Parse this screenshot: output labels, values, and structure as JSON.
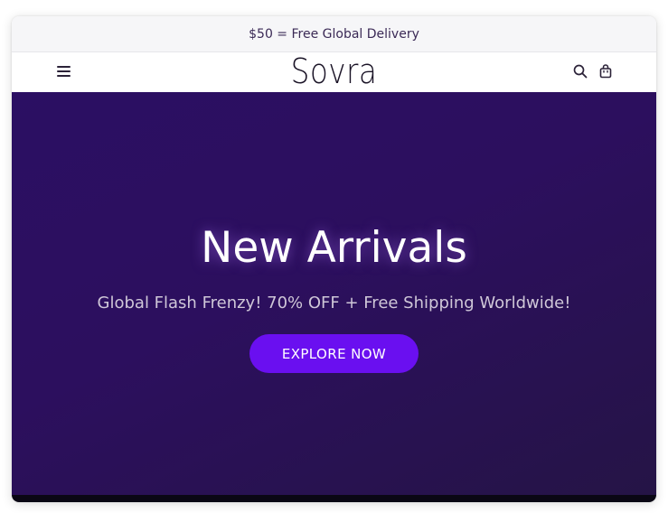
{
  "announcement": {
    "text": "$50 = Free Global Delivery"
  },
  "header": {
    "logo": "Sovra",
    "menu_icon": "hamburger-menu-icon",
    "search_icon": "search-icon",
    "bag_icon": "shopping-bag-icon"
  },
  "hero": {
    "title": "New Arrivals",
    "subtitle": "Global Flash Frenzy! 70% OFF + Free Shipping Worldwide!",
    "cta_label": "EXPLORE NOW"
  },
  "colors": {
    "hero_background": "#2b0f63",
    "cta_background": "#6a0ff0",
    "announcement_background": "#f6f6f8",
    "text_dark": "#1a1326"
  }
}
